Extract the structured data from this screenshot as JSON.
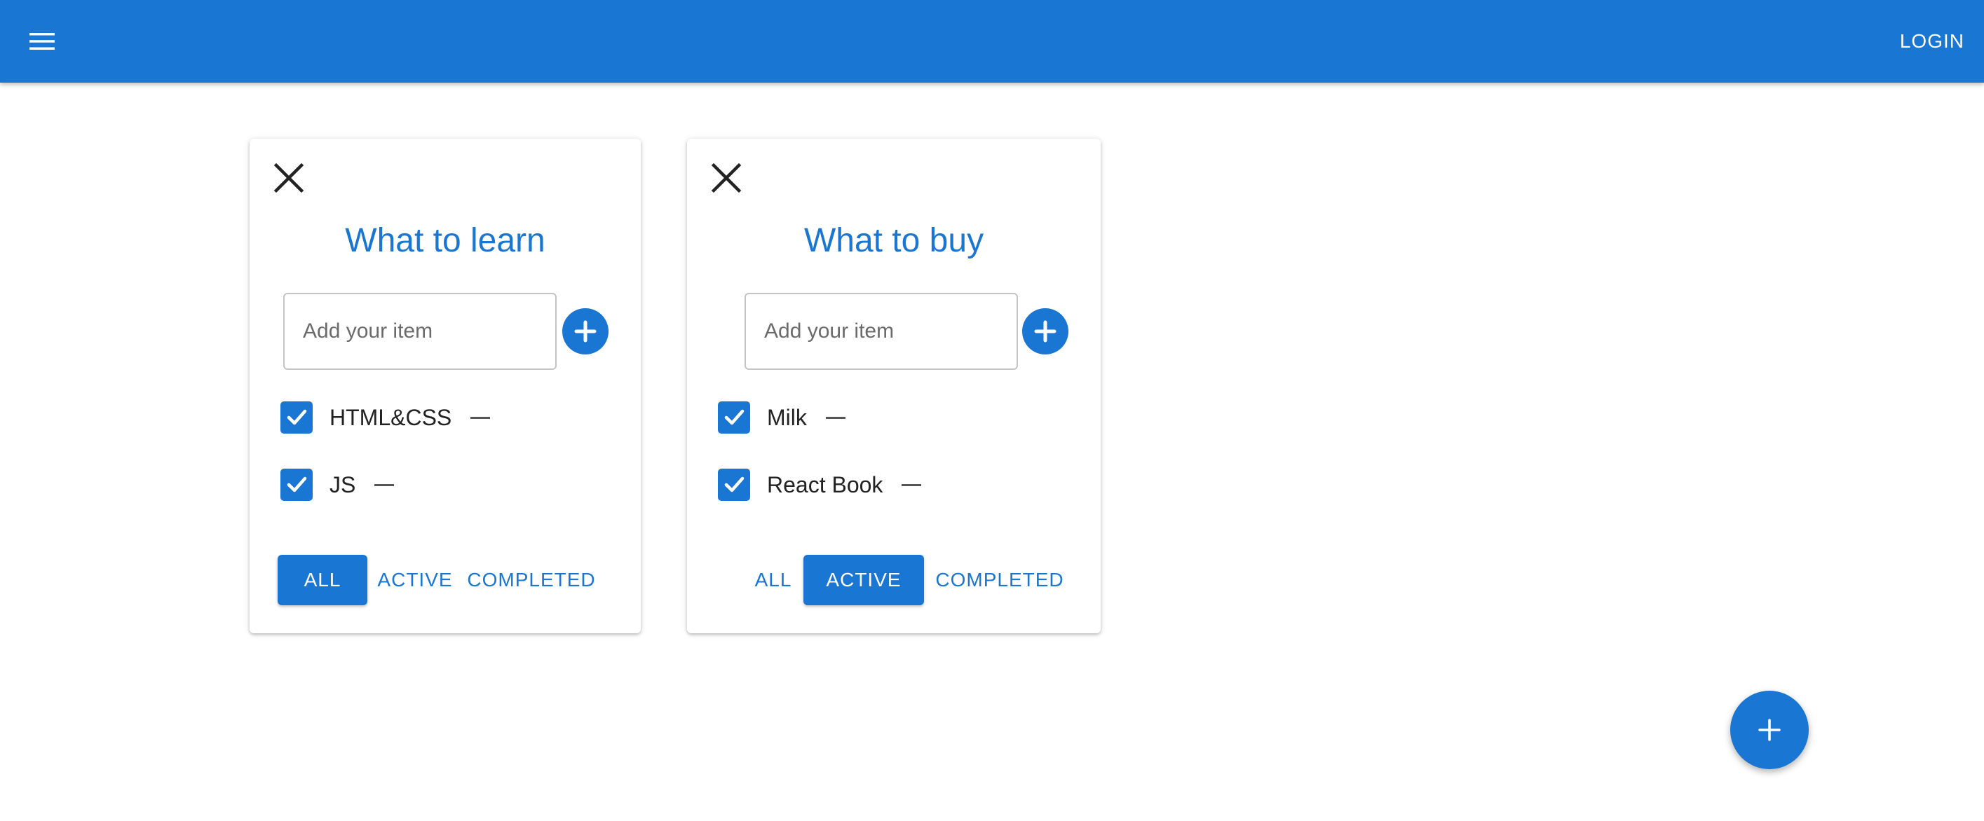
{
  "app_bar": {
    "menu_icon": "hamburger-menu-icon",
    "login_label": "LOGIN",
    "color": "#1976d2"
  },
  "todolists": [
    {
      "title": "What to learn",
      "close_icon": "close-icon",
      "add_input": {
        "placeholder": "Add your item",
        "value": ""
      },
      "add_icon": "add-circle-icon",
      "tasks": [
        {
          "label": "HTML&CSS",
          "checked": true
        },
        {
          "label": "JS",
          "checked": true
        }
      ],
      "filters": [
        {
          "label": "ALL",
          "selected": true
        },
        {
          "label": "ACTIVE",
          "selected": false
        },
        {
          "label": "COMPLETED",
          "selected": false
        }
      ]
    },
    {
      "title": "What to buy",
      "close_icon": "close-icon",
      "add_input": {
        "placeholder": "Add your item",
        "value": ""
      },
      "add_icon": "add-circle-icon",
      "tasks": [
        {
          "label": "Milk",
          "checked": true
        },
        {
          "label": "React Book",
          "checked": true
        }
      ],
      "filters": [
        {
          "label": "ALL",
          "selected": false
        },
        {
          "label": "ACTIVE",
          "selected": true
        },
        {
          "label": "COMPLETED",
          "selected": false
        }
      ]
    }
  ],
  "fab": {
    "icon": "plus-icon"
  },
  "colors": {
    "primary": "#1976d2",
    "background": "#ffffff",
    "text": "#222222"
  }
}
